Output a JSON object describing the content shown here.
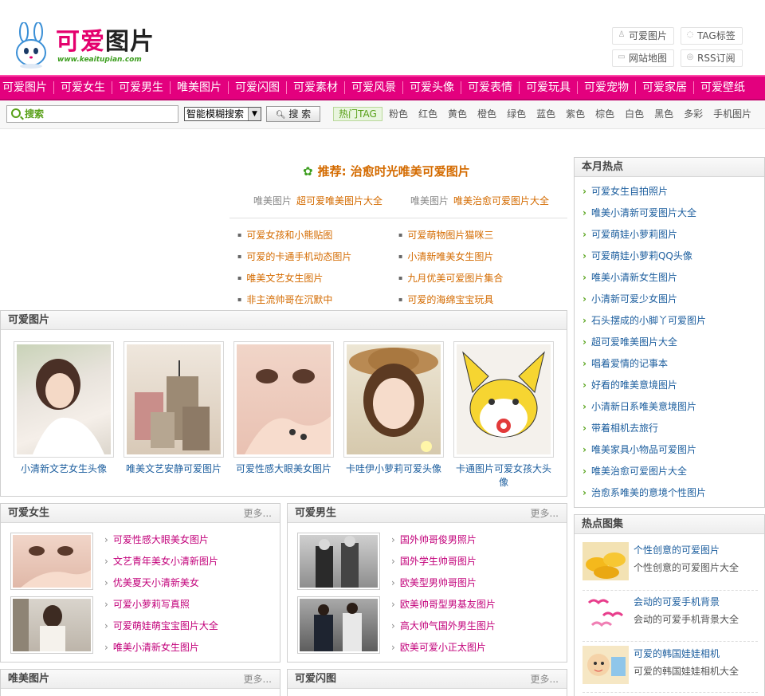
{
  "header": {
    "logo_text": "可爱",
    "logo_text2": "图片",
    "logo_url": "www.keaitupian.com",
    "top_links": [
      "可爱图片",
      "TAG标签",
      "网站地图",
      "RSS订阅"
    ]
  },
  "nav": {
    "items": [
      "可爱图片",
      "可爱女生",
      "可爱男生",
      "唯美图片",
      "可爱闪图",
      "可爱素材",
      "可爱风景",
      "可爱头像",
      "可爱表情",
      "可爱玩具",
      "可爱宠物",
      "可爱家居",
      "可爱壁纸"
    ]
  },
  "search": {
    "placeholder": "搜索",
    "select_value": "智能模糊搜索",
    "button_label": "搜 索",
    "hot_tag_label": "热门TAG",
    "hot_tags": [
      "粉色",
      "红色",
      "黄色",
      "橙色",
      "绿色",
      "蓝色",
      "紫色",
      "棕色",
      "白色",
      "黑色",
      "多彩",
      "手机图片"
    ]
  },
  "recommend": {
    "title": "推荐: 治愈时光唯美可爱图片",
    "pairs": [
      {
        "cat": "唯美图片",
        "link": "超可爱唯美图片大全"
      },
      {
        "cat": "唯美图片",
        "link": "唯美治愈可爱图片大全"
      }
    ],
    "links_left": [
      "可爱女孩和小熊贴图",
      "可爱的卡通手机动态图片",
      "唯美文艺女生图片",
      "非主流帅哥在沉默中"
    ],
    "links_right": [
      "可爱萌物图片猫咪三",
      "小清新唯美女生图片",
      "九月优美可爱图片集合",
      "可爱的海绵宝宝玩具"
    ]
  },
  "cute_pics": {
    "title": "可爱图片",
    "tiles": [
      "小清新文艺女生头像",
      "唯美文艺安静可爱图片",
      "可爱性感大眼美女图片",
      "卡哇伊小萝莉可爱头像",
      "卡通图片可爱女孩大头像"
    ]
  },
  "cute_girls": {
    "title": "可爱女生",
    "more": "更多...",
    "items": [
      "可爱性感大眼美女图片",
      "文艺青年美女小清新图片",
      "优美夏天小清新美女",
      "可爱小萝莉写真照",
      "可爱萌娃萌宝宝图片大全",
      "唯美小清新女生图片"
    ]
  },
  "cute_boys": {
    "title": "可爱男生",
    "more": "更多...",
    "items": [
      "国外帅哥俊男照片",
      "国外学生帅哥图片",
      "欧美型男帅哥图片",
      "欧美帅哥型男基友图片",
      "高大帅气国外男生图片",
      "欧美可爱小正太图片"
    ]
  },
  "bottom_boxes": [
    {
      "title": "唯美图片",
      "more": "更多..."
    },
    {
      "title": "可爱闪图",
      "more": "更多..."
    }
  ],
  "sidebar": {
    "monthly_title": "本月热点",
    "monthly_items": [
      "可爱女生自拍照片",
      "唯美小清新可爱图片大全",
      "可爱萌娃小萝莉图片",
      "可爱萌娃小萝莉QQ头像",
      "唯美小清新女生图片",
      "小清新可爱少女图片",
      "石头摆成的小脚丫可爱图片",
      "超可爱唯美图片大全",
      "唱着爱情的记事本",
      "好看的唯美意境图片",
      "小清新日系唯美意境图片",
      "带着相机去旅行",
      "唯美家具小物品可爱图片",
      "唯美治愈可爱图片大全",
      "治愈系唯美的意境个性图片"
    ],
    "atlas_title": "热点图集",
    "atlas": [
      {
        "title": "个性创意的可爱图片",
        "desc": "个性创意的可爱图片大全"
      },
      {
        "title": "会动的可爱手机背景",
        "desc": "会动的可爱手机背景大全"
      },
      {
        "title": "可爱的韩国娃娃相机",
        "desc": "可爱的韩国娃娃相机大全"
      }
    ]
  },
  "colors": {
    "nav": "#e3007e",
    "accent_orange": "#d46b00",
    "link_blue": "#1c5e9e",
    "link_pink": "#c2007a",
    "green": "#58a018"
  }
}
